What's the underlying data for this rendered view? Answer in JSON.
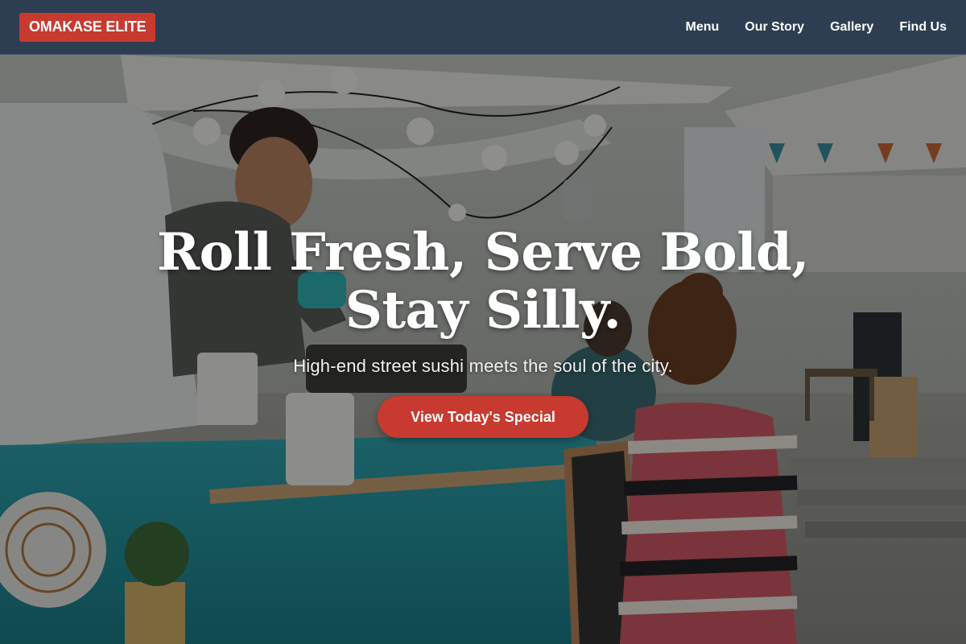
{
  "header": {
    "brand": "OMAKASE ELITE",
    "nav": [
      {
        "label": "Menu"
      },
      {
        "label": "Our Story"
      },
      {
        "label": "Gallery"
      },
      {
        "label": "Find Us"
      }
    ]
  },
  "hero": {
    "title": "Roll Fresh, Serve Bold, Stay Silly.",
    "subtitle": "High-end street sushi meets the soul of the city.",
    "cta_label": "View Today's Special"
  },
  "colors": {
    "header_bg": "#2d3e52",
    "accent": "#c8392f",
    "text": "#ffffff"
  }
}
